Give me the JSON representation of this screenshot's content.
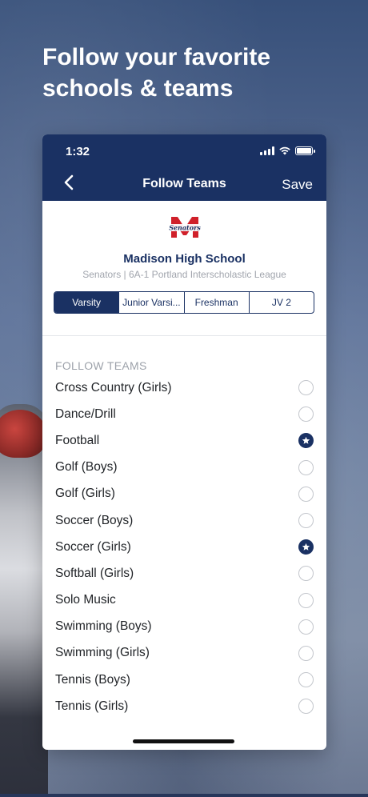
{
  "headline": "Follow your favorite schools & teams",
  "status": {
    "time": "1:32"
  },
  "navbar": {
    "title": "Follow Teams",
    "save_label": "Save",
    "back_icon": "chevron-left-icon"
  },
  "school": {
    "name": "Madison High School",
    "subtitle": "Senators | 6A-1 Portland Interscholastic League",
    "logo_text": "Senators"
  },
  "levels": {
    "selected": "Varsity",
    "options": [
      "Varsity",
      "Junior Varsi...",
      "Freshman",
      "JV 2"
    ]
  },
  "section_title": "FOLLOW TEAMS",
  "teams": [
    {
      "label": "Cross Country (Girls)",
      "followed": false
    },
    {
      "label": "Dance/Drill",
      "followed": false
    },
    {
      "label": "Football",
      "followed": true
    },
    {
      "label": "Golf (Boys)",
      "followed": false
    },
    {
      "label": "Golf (Girls)",
      "followed": false
    },
    {
      "label": "Soccer (Boys)",
      "followed": false
    },
    {
      "label": "Soccer (Girls)",
      "followed": true
    },
    {
      "label": "Softball (Girls)",
      "followed": false
    },
    {
      "label": "Solo Music",
      "followed": false
    },
    {
      "label": "Swimming (Boys)",
      "followed": false
    },
    {
      "label": "Swimming (Girls)",
      "followed": false
    },
    {
      "label": "Tennis (Boys)",
      "followed": false
    },
    {
      "label": "Tennis (Girls)",
      "followed": false
    }
  ],
  "colors": {
    "primary": "#1a3163",
    "logo_red": "#d0202a",
    "muted": "#a1a5ad"
  }
}
